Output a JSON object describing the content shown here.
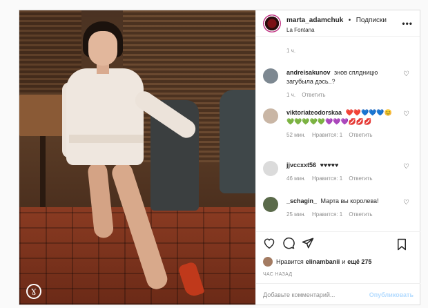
{
  "post": {
    "username": "marta_adamchuk",
    "dot": "•",
    "follow_label": "Подписки",
    "location": "La Fontana",
    "more": "•••",
    "watermark": "Ɣ"
  },
  "comments": {
    "first_time": "1 ч.",
    "items": [
      {
        "user": "andreisakunov",
        "text": "знов сплдницю загубыла дэсь..?",
        "time": "1 ч.",
        "likes": "",
        "reply": "Ответить",
        "avatar_color": "#7d8891"
      },
      {
        "user": "viktoriateodorskaa",
        "text": "❤️❤️💙💙💙😊💚💚💚💚💚💜💜💜💋💋💋",
        "time": "52 мин.",
        "likes": "Нравится: 1",
        "reply": "Ответить",
        "avatar_color": "#c9b6a5"
      },
      {
        "user": "jjvccxxt56",
        "text": "♥♥♥♥♥",
        "time": "46 мин.",
        "likes": "Нравится: 1",
        "reply": "Ответить",
        "avatar_color": "#dbdbdb"
      },
      {
        "user": "_schagin_",
        "text": "Марта вы королева!",
        "time": "25 мин.",
        "likes": "Нравится: 1",
        "reply": "Ответить",
        "avatar_color": "#5a6a4a"
      }
    ]
  },
  "actions": {
    "likes_prefix": "Нравится",
    "likes_user": "elinambanii",
    "likes_and": "и",
    "likes_more": "ещё 275",
    "ago": "ЧАС НАЗАД",
    "comment_placeholder": "Добавьте комментарий...",
    "publish": "Опубликовать"
  },
  "colors": {
    "accent": "#0095f6",
    "publish_disabled": "#b3dbff"
  }
}
